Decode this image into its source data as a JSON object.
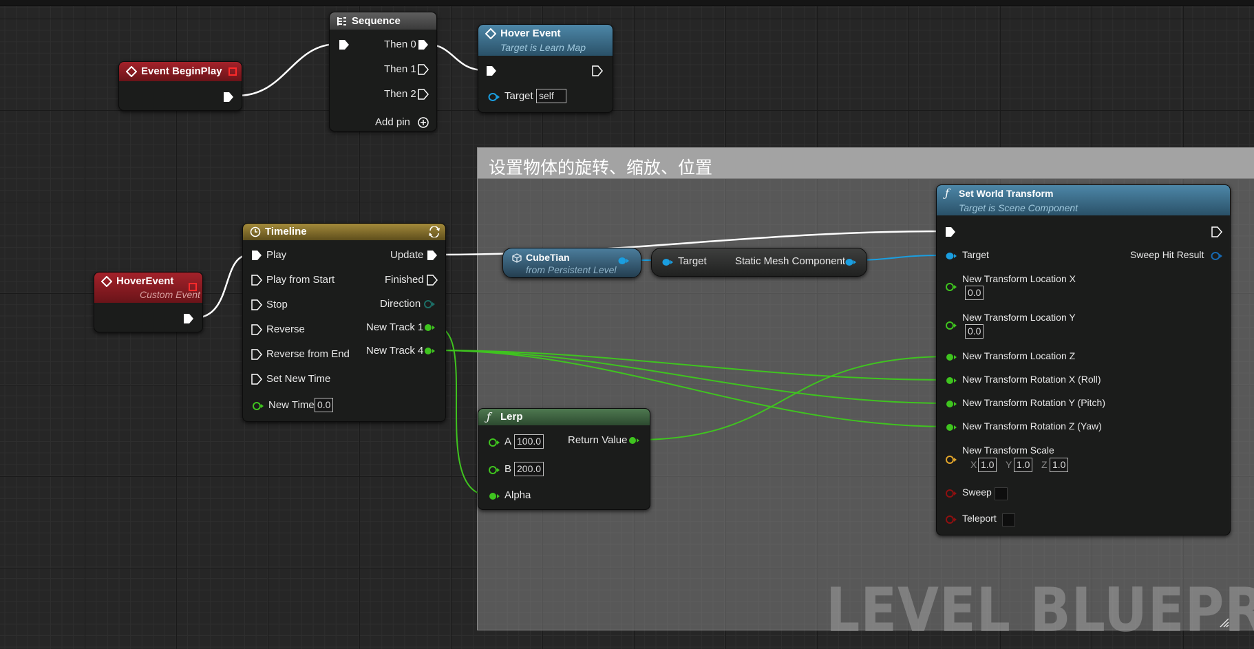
{
  "comment": {
    "title": "设置物体的旋转、缩放、位置"
  },
  "watermark": "LEVEL BLUEPRINT",
  "nodes": {
    "begin_play": {
      "title": "Event BeginPlay"
    },
    "sequence": {
      "title": "Sequence",
      "pins": [
        "Then 0",
        "Then 1",
        "Then 2"
      ],
      "add_pin": "Add pin"
    },
    "hover_event_call": {
      "title": "Hover Event",
      "subtitle": "Target is Learn Map",
      "target_label": "Target",
      "target_value": "self"
    },
    "custom_event": {
      "title": "HoverEvent",
      "subtitle": "Custom Event"
    },
    "timeline": {
      "title": "Timeline",
      "inputs": [
        "Play",
        "Play from Start",
        "Stop",
        "Reverse",
        "Reverse from End",
        "Set New Time"
      ],
      "outputs": [
        "Update",
        "Finished",
        "Direction",
        "New Track 1",
        "New Track 4"
      ],
      "new_time_label": "New Time",
      "new_time_value": "0.0"
    },
    "cube": {
      "title": "CubeTian",
      "subtitle": "from Persistent Level"
    },
    "getter": {
      "target": "Target",
      "output": "Static Mesh Component"
    },
    "lerp": {
      "title": "Lerp",
      "a_label": "A",
      "a_value": "100.0",
      "b_label": "B",
      "b_value": "200.0",
      "alpha_label": "Alpha",
      "return_label": "Return Value"
    },
    "set_transform": {
      "title": "Set World Transform",
      "subtitle": "Target is Scene Component",
      "target": "Target",
      "sweep_hit": "Sweep Hit Result",
      "loc_x": "New Transform Location X",
      "loc_x_value": "0.0",
      "loc_y": "New Transform Location Y",
      "loc_y_value": "0.0",
      "loc_z": "New Transform Location Z",
      "rot_x": "New Transform Rotation X (Roll)",
      "rot_y": "New Transform Rotation Y (Pitch)",
      "rot_z": "New Transform Rotation Z (Yaw)",
      "scale": "New Transform Scale",
      "scale_x_label": "X",
      "scale_x": "1.0",
      "scale_y_label": "Y",
      "scale_y": "1.0",
      "scale_z_label": "Z",
      "scale_z": "1.0",
      "sweep": "Sweep",
      "teleport": "Teleport"
    }
  },
  "colors": {
    "exec_wire": "#ffffff",
    "float_wire": "#3fc41f",
    "object_wire": "#1a9ee0",
    "struct_pin": "#e3a52a",
    "bool_pin": "#8f1010",
    "event_header": "#a4222a",
    "function_header": "#4d87a8",
    "timeline_header": "#a38a3a"
  },
  "icons": {
    "event": "event-diamond-icon",
    "function": "function-f-icon",
    "sequence": "sequence-icon",
    "timeline": "clock-icon",
    "loop": "loop-icon",
    "add": "add-pin-icon"
  }
}
